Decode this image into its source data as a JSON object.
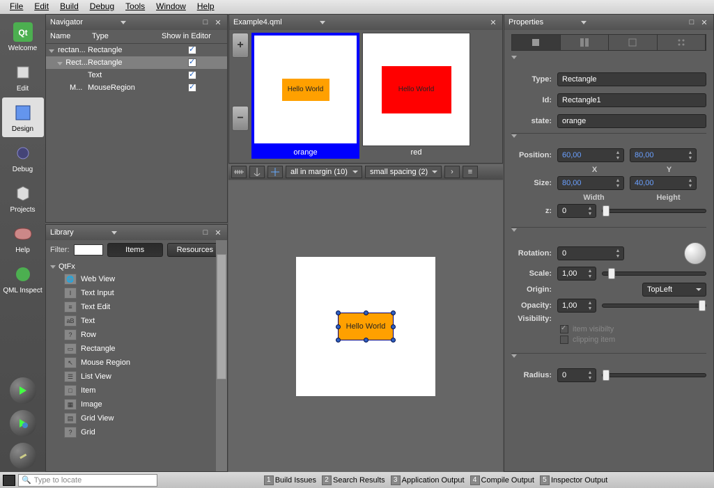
{
  "menu": [
    "File",
    "Edit",
    "Build",
    "Debug",
    "Tools",
    "Window",
    "Help"
  ],
  "sidebar": [
    {
      "label": "Welcome",
      "icon": "qt"
    },
    {
      "label": "Edit",
      "icon": "edit"
    },
    {
      "label": "Design",
      "icon": "design",
      "active": true
    },
    {
      "label": "Debug",
      "icon": "debug"
    },
    {
      "label": "Projects",
      "icon": "projects"
    },
    {
      "label": "Help",
      "icon": "help"
    },
    {
      "label": "QML Inspect",
      "icon": "qml"
    }
  ],
  "navigator": {
    "title": "Navigator",
    "headers": [
      "Name",
      "Type",
      "Show in Editor"
    ],
    "tree": [
      {
        "name": "rectan...",
        "type": "Rectangle",
        "checked": true,
        "level": 0,
        "expanded": true
      },
      {
        "name": "Rect...",
        "type": "Rectangle",
        "checked": true,
        "level": 1,
        "expanded": true,
        "selected": true
      },
      {
        "name": "",
        "type": "Text",
        "checked": true,
        "level": 2
      },
      {
        "name": "M...",
        "type": "MouseRegion",
        "checked": true,
        "level": 2
      }
    ]
  },
  "library": {
    "title": "Library",
    "filter_label": "Filter:",
    "filter_value": "",
    "tabs": [
      "Items",
      "Resources"
    ],
    "active_tab": "Items",
    "category": "QtFx",
    "items": [
      "Web View",
      "Text Input",
      "Text Edit",
      "Text",
      "Row",
      "Rectangle",
      "Mouse Region",
      "List View",
      "Item",
      "Image",
      "Grid View",
      "Grid"
    ]
  },
  "editor": {
    "filename": "Example4.qml",
    "states": [
      {
        "name": "orange",
        "selected": true,
        "bg": "orange",
        "text": "Hello World"
      },
      {
        "name": "red",
        "selected": false,
        "bg": "red",
        "text": "Hello World"
      }
    ],
    "toolbar": {
      "margin": "all in margin (10)",
      "spacing": "small spacing (2)"
    },
    "canvas": {
      "text": "Hello World"
    }
  },
  "properties": {
    "title": "Properties",
    "type": {
      "label": "Type:",
      "value": "Rectangle"
    },
    "id": {
      "label": "Id:",
      "value": "Rectangle1"
    },
    "state": {
      "label": "state:",
      "value": "orange"
    },
    "position": {
      "label": "Position:",
      "x": "60,00",
      "y": "80,00",
      "xl": "X",
      "yl": "Y"
    },
    "size": {
      "label": "Size:",
      "w": "80,00",
      "h": "40,00",
      "wl": "Width",
      "hl": "Height"
    },
    "z": {
      "label": "z:",
      "value": "0"
    },
    "rotation": {
      "label": "Rotation:",
      "value": "0"
    },
    "scale": {
      "label": "Scale:",
      "value": "1,00"
    },
    "origin": {
      "label": "Origin:",
      "value": "TopLeft"
    },
    "opacity": {
      "label": "Opacity:",
      "value": "1,00"
    },
    "visibility": {
      "label": "Visibility:",
      "items": [
        {
          "label": "item visibilty",
          "checked": true
        },
        {
          "label": "clipping item",
          "checked": false
        }
      ]
    },
    "radius": {
      "label": "Radius:",
      "value": "0"
    }
  },
  "statusbar": {
    "search_placeholder": "Type to locate",
    "items": [
      {
        "n": "1",
        "label": "Build Issues"
      },
      {
        "n": "2",
        "label": "Search Results"
      },
      {
        "n": "3",
        "label": "Application Output"
      },
      {
        "n": "4",
        "label": "Compile Output"
      },
      {
        "n": "5",
        "label": "Inspector Output"
      }
    ]
  }
}
